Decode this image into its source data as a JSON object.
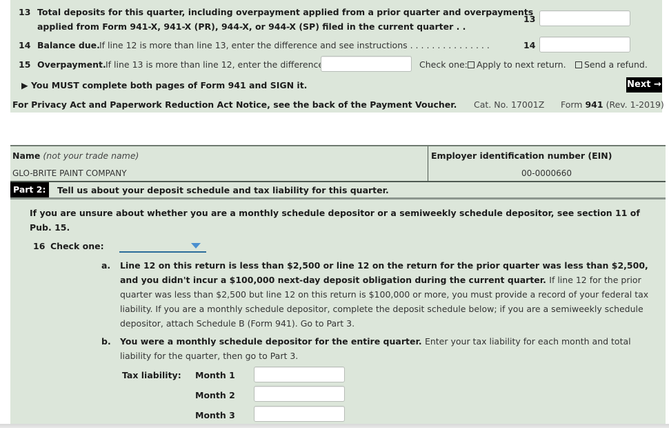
{
  "top_section": {
    "line13": {
      "number": "13",
      "text_line1": "Total deposits for this quarter, including overpayment applied from a prior quarter and overpayments",
      "text_line2": "applied from Form 941-X, 941-X (PR), 944-X, or 944-X (SP) filed in the current quarter . .",
      "field_label": "13",
      "value": ""
    },
    "line14": {
      "number": "14",
      "title": "Balance due.",
      "text": "If line 12 is more than line 13, enter the difference and see instructions . . . . . . . . . . . . . . .",
      "field_label": "14",
      "value": ""
    },
    "line15": {
      "number": "15",
      "title": "Overpayment.",
      "text": "If line 13 is more than line 12, enter the difference",
      "value": "",
      "check_one_label": "Check one:",
      "option_apply": "Apply to next return.",
      "option_refund": "Send a refund."
    },
    "must_complete": "▶ You MUST complete both pages of Form 941 and SIGN it.",
    "next_button": "Next →",
    "privacy_notice": "For Privacy Act and Paperwork Reduction Act Notice, see the back of the Payment Voucher.",
    "cat_no": "Cat. No. 17001Z",
    "form_prefix": "Form",
    "form_number": "941",
    "form_rev": "(Rev. 1-2019)"
  },
  "bottom_section": {
    "name_label": "Name",
    "name_label_note": "(not your trade name)",
    "name_value": "GLO-BRITE PAINT COMPANY",
    "ein_label": "Employer identification number (EIN)",
    "ein_value": "00-0000660",
    "part_tag": "Part 2:",
    "part_title": "Tell us about your deposit schedule and tax liability for this quarter.",
    "intro": "If you are unsure about whether you are a monthly schedule depositor or a semiweekly schedule depositor, see section 11 of Pub. 15.",
    "line16_number": "16",
    "line16_label": "Check one:",
    "line16_selected": "",
    "option_a": {
      "letter": "a.",
      "bold_text": "Line 12 on this return is less than $2,500 or line 12 on the return for the prior quarter was less than $2,500, and you didn't incur a $100,000 next-day deposit obligation during the current quarter.",
      "normal_text": "If line 12 for the prior quarter was less than $2,500 but line 12 on this return is $100,000 or more, you must provide a record of your federal tax liability. If you are a monthly schedule depositor, complete the deposit schedule below; if you are a semiweekly schedule depositor, attach Schedule B (Form 941). Go to Part 3."
    },
    "option_b": {
      "letter": "b.",
      "bold_text": "You were a monthly schedule depositor for the entire quarter.",
      "normal_text": "Enter your tax liability for each month and total liability for the quarter, then go to Part 3."
    },
    "tax_liability_label": "Tax liability:",
    "months": [
      {
        "label": "Month 1",
        "value": ""
      },
      {
        "label": "Month 2",
        "value": ""
      },
      {
        "label": "Month 3",
        "value": ""
      }
    ]
  },
  "colors": {
    "panel_background": "#dce6da",
    "dropdown_accent": "#4a8fcf"
  }
}
